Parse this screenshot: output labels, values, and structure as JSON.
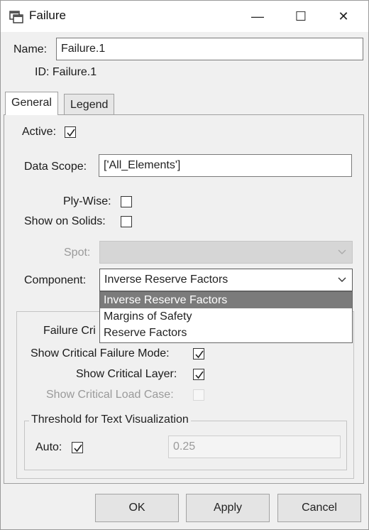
{
  "window": {
    "title": "Failure",
    "minimize_glyph": "—",
    "maximize_glyph": "☐",
    "close_glyph": "✕",
    "icon": "app-window-icon"
  },
  "header": {
    "name_label": "Name:",
    "name_value": "Failure.1",
    "id_text": "ID: Failure.1"
  },
  "tabs": [
    {
      "label": "General",
      "active": true
    },
    {
      "label": "Legend",
      "active": false
    }
  ],
  "general": {
    "active_label": "Active:",
    "active_checked": true,
    "data_scope_label": "Data Scope:",
    "data_scope_value": "['All_Elements']",
    "ply_wise_label": "Ply-Wise:",
    "ply_wise_checked": false,
    "show_on_solids_label": "Show on Solids:",
    "show_on_solids_checked": false,
    "spot_label": "Spot:",
    "spot_value": "",
    "component_label": "Component:",
    "component_value": "Inverse Reserve Factors",
    "component_options": [
      "Inverse Reserve Factors",
      "Margins of Safety",
      "Reserve Factors"
    ],
    "selected_option_index": 0
  },
  "critical": {
    "group_title": "Failure Cri",
    "show_failure_mode_label": "Show Critical Failure Mode:",
    "show_failure_mode_checked": true,
    "show_layer_label": "Show Critical Layer:",
    "show_layer_checked": true,
    "show_load_case_label": "Show Critical Load Case:",
    "show_load_case_checked": false,
    "threshold_title": "Threshold for Text Visualization",
    "auto_label": "Auto:",
    "auto_checked": true,
    "threshold_value": "0.25"
  },
  "buttons": {
    "ok": "OK",
    "apply": "Apply",
    "cancel": "Cancel"
  }
}
